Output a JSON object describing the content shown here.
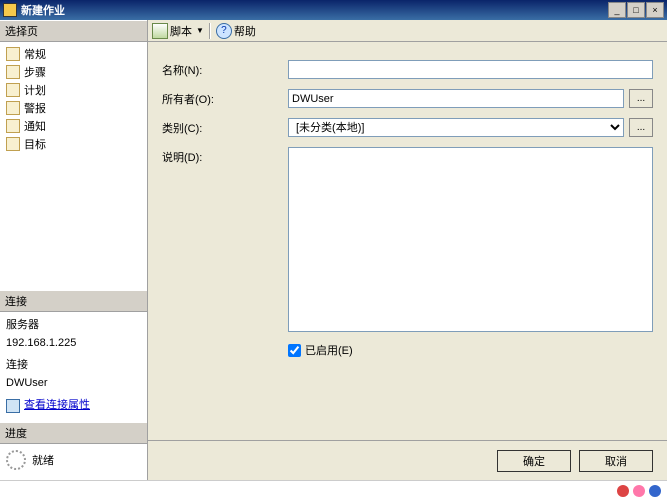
{
  "window": {
    "title": "新建作业",
    "min": "_",
    "max": "□",
    "close": "×"
  },
  "sidebar": {
    "pages_header": "选择页",
    "items": [
      {
        "label": "常规"
      },
      {
        "label": "步骤"
      },
      {
        "label": "计划"
      },
      {
        "label": "警报"
      },
      {
        "label": "通知"
      },
      {
        "label": "目标"
      }
    ],
    "connection_header": "连接",
    "server_label": "服务器",
    "server_value": "192.168.1.225",
    "conn_label": "连接",
    "conn_value": "DWUser",
    "view_props": "查看连接属性",
    "progress_header": "进度",
    "progress_text": "就绪"
  },
  "toolbar": {
    "script": "脚本",
    "help": "帮助"
  },
  "form": {
    "name_label": "名称(N):",
    "name_value": "",
    "owner_label": "所有者(O):",
    "owner_value": "DWUser",
    "category_label": "类别(C):",
    "category_value": "[未分类(本地)]",
    "desc_label": "说明(D):",
    "desc_value": "",
    "enabled_label": "已启用(E)",
    "ellipsis": "..."
  },
  "buttons": {
    "ok": "确定",
    "cancel": "取消"
  }
}
